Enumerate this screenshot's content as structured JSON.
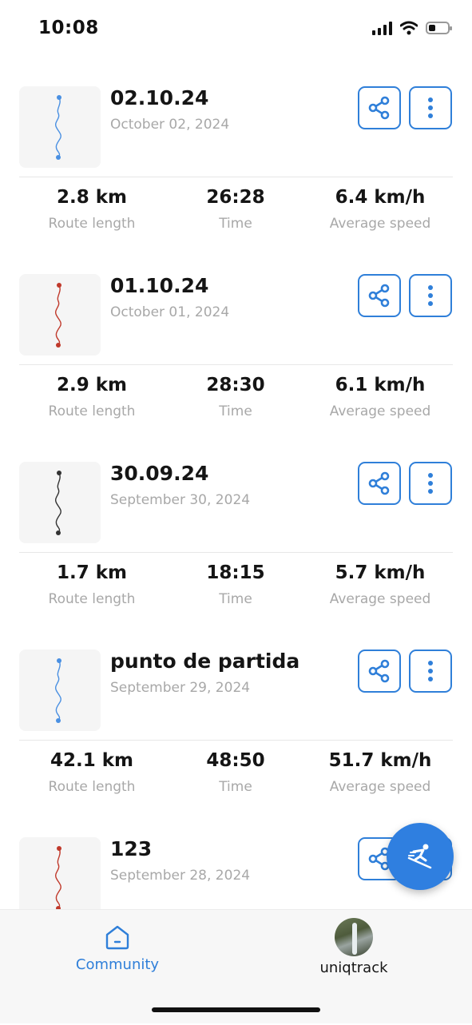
{
  "status": {
    "time": "10:08",
    "signal_icon": "signal-bars-icon",
    "wifi_icon": "wifi-icon",
    "battery_icon": "battery-icon",
    "battery_level": 0.35
  },
  "stat_labels": {
    "length": "Route length",
    "time": "Time",
    "speed": "Average speed"
  },
  "tracks": [
    {
      "title": "02.10.24",
      "date": "October 02, 2024",
      "length": "2.8 km",
      "time": "26:28",
      "speed": "6.4 km/h",
      "route_color": "#4a90e2"
    },
    {
      "title": "01.10.24",
      "date": "October 01, 2024",
      "length": "2.9 km",
      "time": "28:30",
      "speed": "6.1 km/h",
      "route_color": "#c0392b"
    },
    {
      "title": "30.09.24",
      "date": "September 30, 2024",
      "length": "1.7 km",
      "time": "18:15",
      "speed": "5.7 km/h",
      "route_color": "#333333"
    },
    {
      "title": "punto de partida",
      "date": "September 29, 2024",
      "length": "42.1 km",
      "time": "48:50",
      "speed": "51.7 km/h",
      "route_color": "#4a90e2"
    },
    {
      "title": "123",
      "date": "September 28, 2024",
      "length": "",
      "time": "",
      "speed": "",
      "route_color": "#c0392b"
    }
  ],
  "fab": {
    "icon": "skier-icon"
  },
  "nav": {
    "community_label": "Community",
    "community_icon": "home-icon",
    "profile_label": "uniqtrack"
  },
  "colors": {
    "accent": "#2f7fd9"
  }
}
